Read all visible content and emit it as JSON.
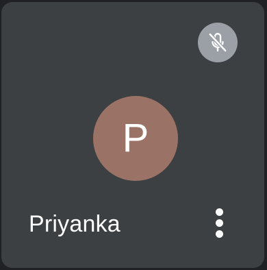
{
  "participant": {
    "initial": "P",
    "name": "Priyanka",
    "avatar_color": "#9b7366",
    "mic_status_icon": "mic-off-icon",
    "menu_icon": "more-vertical-icon"
  },
  "colors": {
    "tile_background": "#3c4043",
    "page_background": "#202124",
    "mic_badge": "#9aa0a6",
    "text": "#ffffff"
  }
}
